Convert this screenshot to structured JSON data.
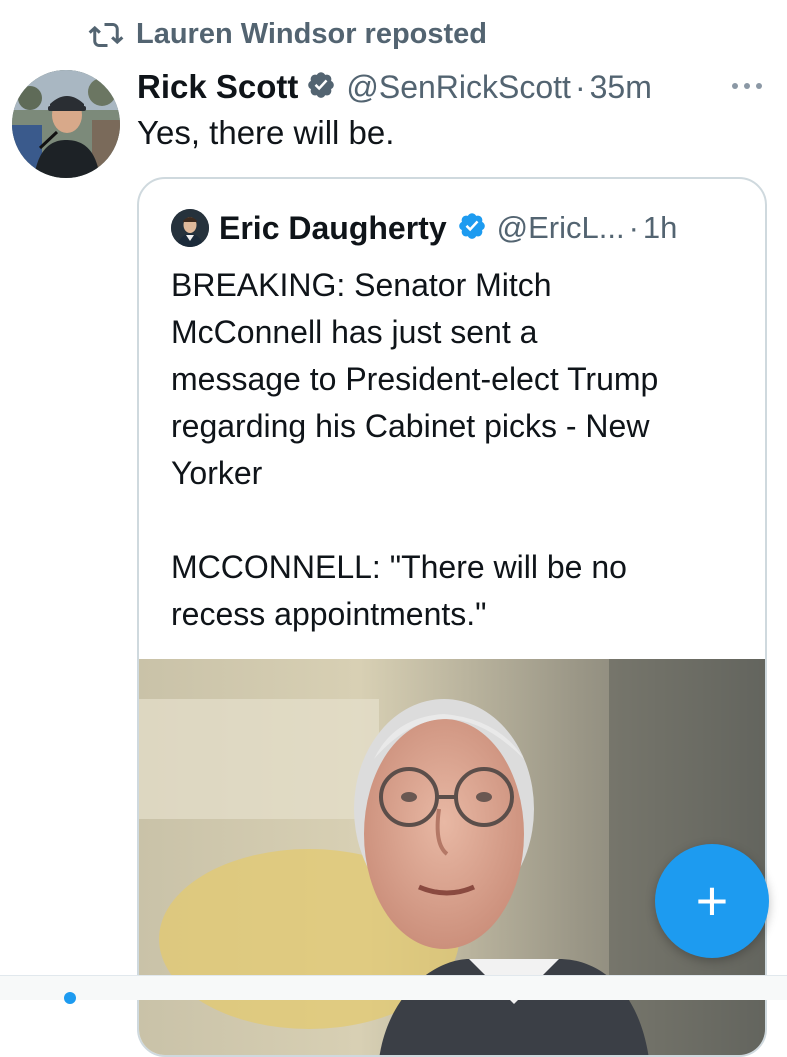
{
  "repost": {
    "icon": "repost-icon",
    "text": "Lauren Windsor reposted"
  },
  "tweet": {
    "avatar": "rick-scott-avatar-photo",
    "name": "Rick Scott",
    "verified_icon": "verified-badge-icon",
    "handle": "@SenRickScott",
    "separator": "·",
    "time": "35m",
    "more_icon": "more-options-icon",
    "text": "Yes, there will be."
  },
  "quote": {
    "avatar": "eric-daugherty-avatar-photo",
    "name": "Eric Daugherty",
    "verified_icon": "verified-badge-icon",
    "handle": "@EricL...",
    "separator": "·",
    "time": "1h",
    "lines": [
      "BREAKING: Senator Mitch",
      "McConnell has just sent a",
      "message to President-elect Trump",
      "regarding his Cabinet picks - New",
      "Yorker",
      "",
      "MCCONNELL: \"There will be no",
      "recess appointments.\""
    ],
    "image": "mitch-mcconnell-photo"
  },
  "fab": {
    "label": "+",
    "icon": "compose-plus-icon"
  },
  "colors": {
    "accent": "#1d9bf0",
    "text": "#0f1419",
    "muted": "#536471",
    "border": "#cfd9de"
  }
}
